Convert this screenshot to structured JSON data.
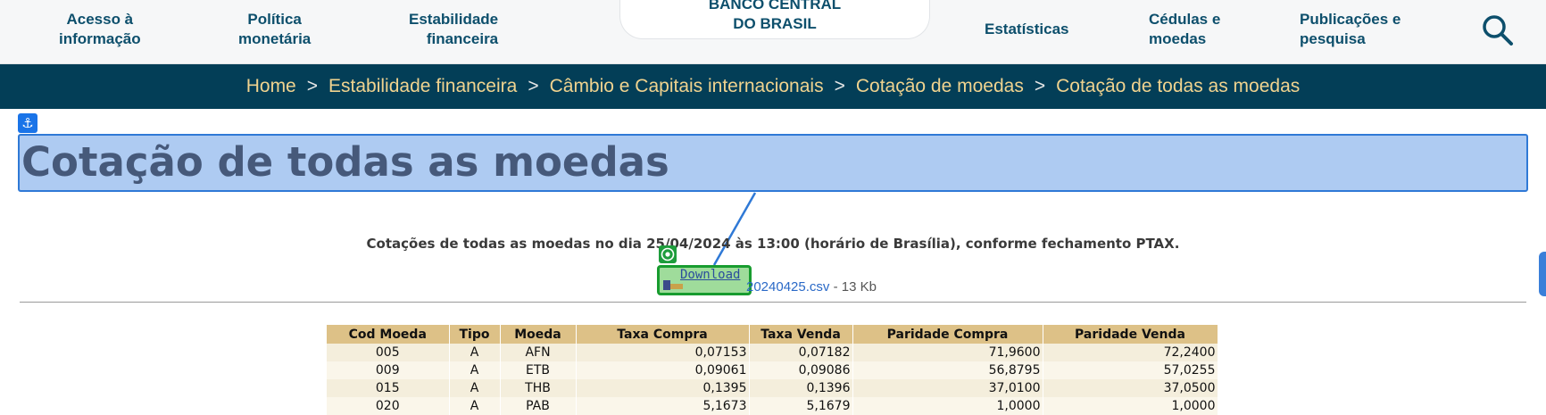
{
  "nav": {
    "items_left": [
      {
        "label": "Acesso à\ninformação"
      },
      {
        "label": "Política\nmonetária"
      },
      {
        "label": "Estabilidade\nfinanceira"
      }
    ],
    "logo": "BANCO CENTRAL\nDO BRASIL",
    "items_right": [
      {
        "label": "Estatísticas"
      },
      {
        "label": "Cédulas e\nmoedas"
      },
      {
        "label": "Publicações e\npesquisa"
      }
    ],
    "search_icon": "search-icon"
  },
  "breadcrumb": {
    "items": [
      "Home",
      "Estabilidade financeira",
      "Câmbio e Capitais internacionais",
      "Cotação de moedas",
      "Cotação de todas as moedas"
    ],
    "separator": ">"
  },
  "page": {
    "title": "Cotação de todas as moedas",
    "subtitle": "Cotações de todas as moedas no dia 25/04/2024 às 13:00 (horário de Brasília), conforme fechamento PTAX.",
    "download_label": "Download",
    "file_name": "20240425.csv",
    "file_size": " - 13 Kb"
  },
  "table": {
    "headers": [
      "Cod Moeda",
      "Tipo",
      "Moeda",
      "Taxa Compra",
      "Taxa Venda",
      "Paridade Compra",
      "Paridade Venda"
    ],
    "rows": [
      [
        "005",
        "A",
        "AFN",
        "0,07153",
        "0,07182",
        "71,9600",
        "72,2400"
      ],
      [
        "009",
        "A",
        "ETB",
        "0,09061",
        "0,09086",
        "56,8795",
        "57,0255"
      ],
      [
        "015",
        "A",
        "THB",
        "0,1395",
        "0,1396",
        "37,0100",
        "37,0500"
      ],
      [
        "020",
        "A",
        "PAB",
        "5,1673",
        "5,1679",
        "1,0000",
        "1,0000"
      ]
    ]
  },
  "colors": {
    "brand": "#033e57",
    "breadcrumb_text": "#f0d38f",
    "table_header": "#ddc187",
    "highlight": "#aecbf2"
  }
}
